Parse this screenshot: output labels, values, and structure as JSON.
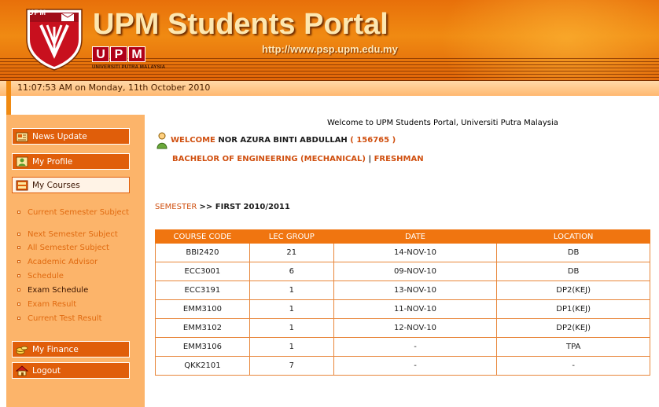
{
  "header": {
    "title": "UPM Students Portal",
    "url": "http://www.psp.upm.edu.my",
    "logo_small_text": "UPM",
    "badge_letters": [
      "U",
      "P",
      "M"
    ],
    "university_name": "UNIVERSITI PUTRA MALAYSIA"
  },
  "datebar": {
    "datetime": "11:07:53 AM on Monday, 11th October 2010"
  },
  "sidebar": {
    "news_update": "News Update",
    "my_profile": "My Profile",
    "my_courses": "My Courses",
    "submenu": [
      "Current Semester Subject",
      "Next Semester Subject",
      "All Semester Subject",
      "Academic Advisor",
      "Schedule",
      "Exam Schedule",
      "Exam Result",
      "Current Test Result"
    ],
    "my_finance": "My Finance",
    "logout": "Logout"
  },
  "main": {
    "welcome_top": "Welcome to UPM Students Portal, Universiti Putra Malaysia",
    "welcome_label": "WELCOME",
    "student_name": "NOR AZURA BINTI ABDULLAH",
    "student_id": "( 156765 )",
    "program": "BACHELOR OF ENGINEERING (MECHANICAL)",
    "separator": "|",
    "status": "FRESHMAN",
    "semester_label": "SEMESTER",
    "semester_value": ">> FIRST 2010/2011"
  },
  "table": {
    "headers": [
      "COURSE CODE",
      "LEC GROUP",
      "DATE",
      "LOCATION"
    ],
    "rows": [
      [
        "BBI2420",
        "21",
        "14-NOV-10",
        "DB"
      ],
      [
        "ECC3001",
        "6",
        "09-NOV-10",
        "DB"
      ],
      [
        "ECC3191",
        "1",
        "13-NOV-10",
        "DP2(KEJ)"
      ],
      [
        "EMM3100",
        "1",
        "11-NOV-10",
        "DP1(KEJ)"
      ],
      [
        "EMM3102",
        "1",
        "12-NOV-10",
        "DP2(KEJ)"
      ],
      [
        "EMM3106",
        "1",
        "-",
        "TPA"
      ],
      [
        "QKK2101",
        "7",
        "-",
        "-"
      ]
    ]
  },
  "colors": {
    "header_orange": "#f08a12",
    "accent": "#e05e0a",
    "link": "#d05010",
    "sidebar_bg": "#fcb46a"
  },
  "icons": {
    "news_update": "newspaper-icon",
    "my_profile": "profile-icon",
    "my_courses": "courses-icon",
    "my_finance": "coins-icon",
    "logout": "home-icon",
    "user": "user-icon",
    "logo": "upm-shield-logo"
  }
}
